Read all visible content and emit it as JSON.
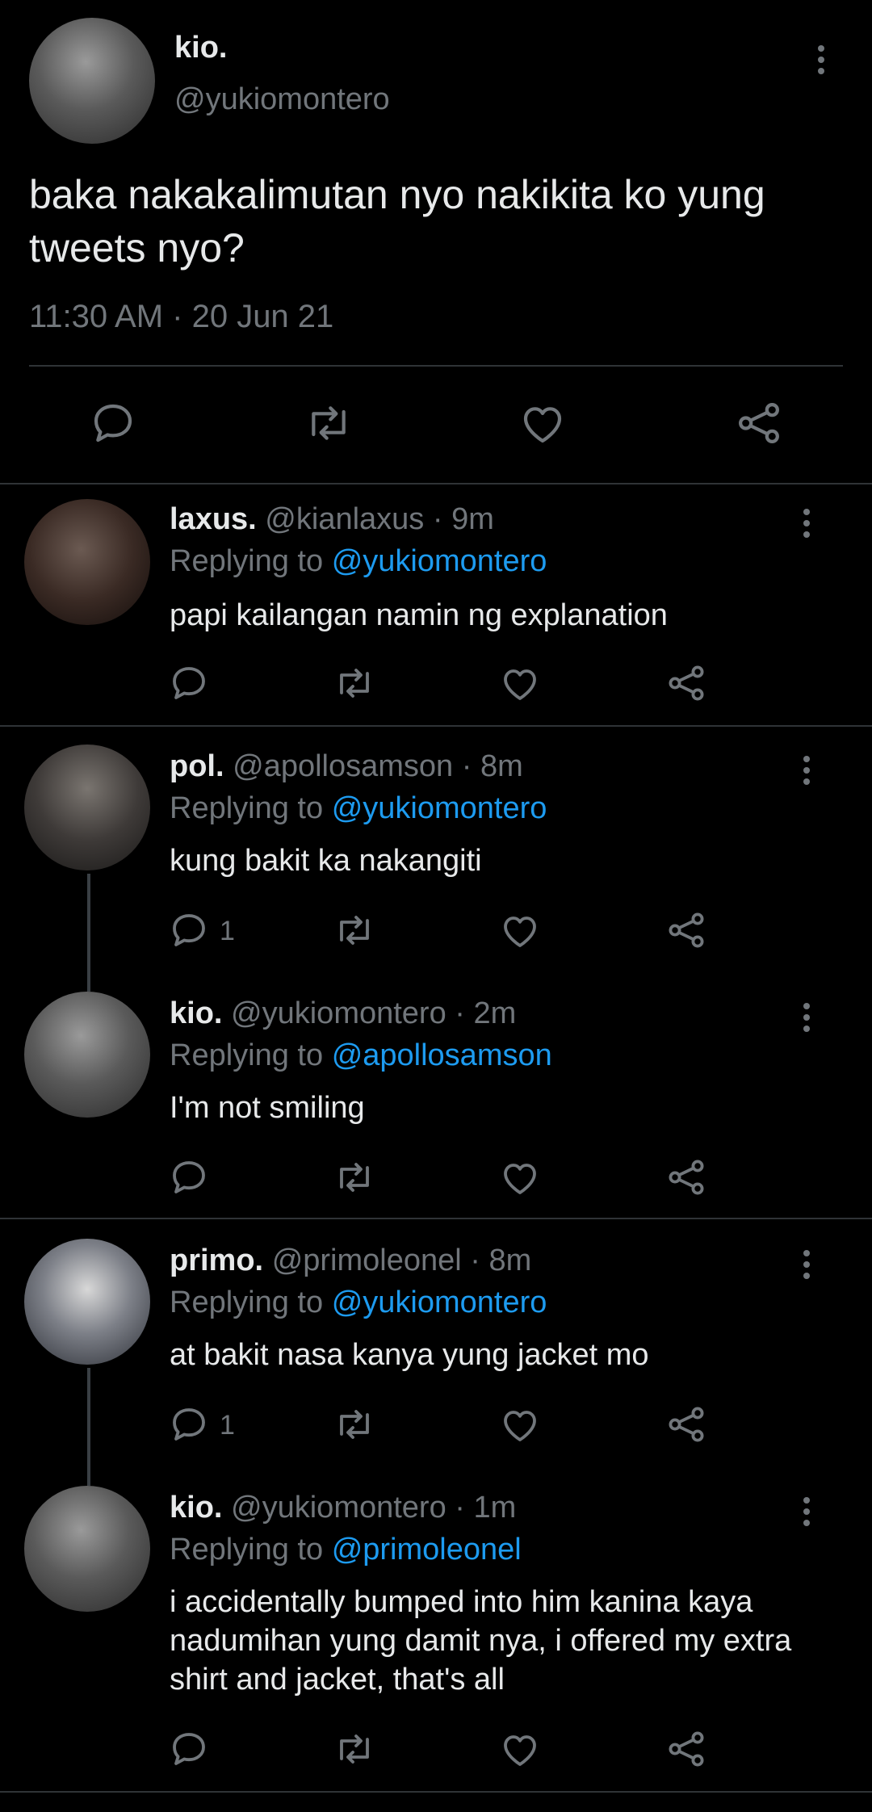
{
  "main": {
    "name": "kio.",
    "handle": "@yukiomontero",
    "text": "baka nakakalimutan nyo nakikita ko yung tweets nyo?",
    "time": "11:30 AM · 20 Jun 21"
  },
  "replies": [
    {
      "name": "laxus.",
      "handle": "@kianlaxus",
      "age": "· 9m",
      "replying_label": "Replying to",
      "replying_to": "@yukiomontero",
      "text": "papi kailangan namin ng explanation",
      "reply_count": ""
    },
    {
      "name": "pol.",
      "handle": "@apollosamson",
      "age": "· 8m",
      "replying_label": "Replying to",
      "replying_to": "@yukiomontero",
      "text": "kung bakit ka nakangiti",
      "reply_count": "1"
    },
    {
      "name": "kio.",
      "handle": "@yukiomontero",
      "age": "· 2m",
      "replying_label": "Replying to",
      "replying_to": "@apollosamson",
      "text": "I'm not smiling",
      "reply_count": ""
    },
    {
      "name": "primo.",
      "handle": "@primoleonel",
      "age": "· 8m",
      "replying_label": "Replying to",
      "replying_to": "@yukiomontero",
      "text": "at bakit nasa kanya yung jacket mo",
      "reply_count": "1"
    },
    {
      "name": "kio.",
      "handle": "@yukiomontero",
      "age": "· 1m",
      "replying_label": "Replying to",
      "replying_to": "@primoleonel",
      "text": "i accidentally bumped into him kanina kaya nadumihan yung damit nya, i offered my extra shirt and jacket, that's all",
      "reply_count": ""
    }
  ],
  "icons": {
    "reply": "reply-icon",
    "retweet": "retweet-icon",
    "like": "heart-icon",
    "share": "share-icon",
    "more": "more-vertical-icon"
  },
  "colors": {
    "background": "#000000",
    "text": "#e7e9ea",
    "muted": "#71767b",
    "link": "#1d9bf0",
    "separator": "#2f3336"
  }
}
